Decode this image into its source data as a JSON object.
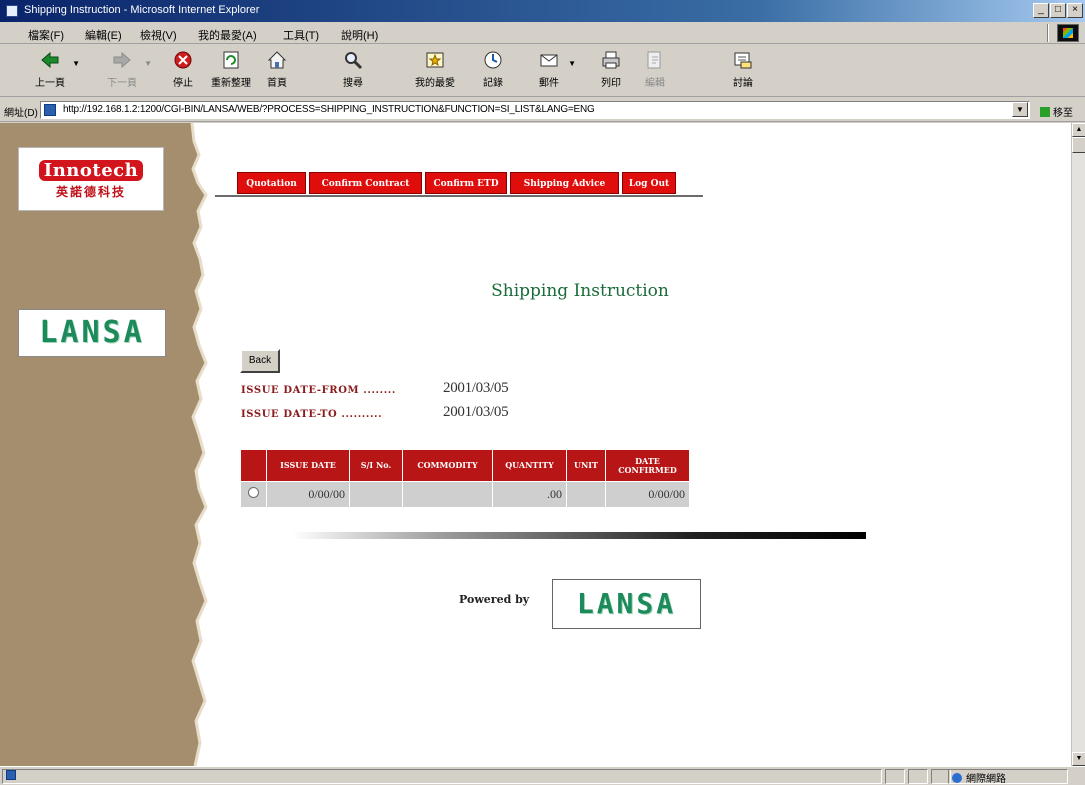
{
  "window": {
    "title": "Shipping Instruction - Microsoft Internet Explorer"
  },
  "menu": [
    "檔案(F)",
    "編輯(E)",
    "檢視(V)",
    "我的最愛(A)",
    "工具(T)",
    "說明(H)"
  ],
  "toolbar": {
    "back": "上一頁",
    "forward": "下一頁",
    "stop": "停止",
    "refresh": "重新整理",
    "home": "首頁",
    "search": "搜尋",
    "favorites": "我的最愛",
    "history": "記錄",
    "mail": "郵件",
    "print": "列印",
    "edit": "編輯",
    "messenger": "討論"
  },
  "address": {
    "label": "網址(D)",
    "url": "http://192.168.1.2:1200/CGI-BIN/LANSA/WEB/?PROCESS=SHIPPING_INSTRUCTION&FUNCTION=SI_LIST&LANG=ENG",
    "go_label": "移至"
  },
  "logos": {
    "innotech_brand": "Innotech",
    "innotech_chinese": "英諾德科技",
    "lanse_brand": "LANSA"
  },
  "nav": {
    "tabs": [
      "Quotation",
      "Confirm Contract",
      "Confirm ETD",
      "Shipping Advice",
      "Log Out"
    ]
  },
  "page": {
    "title": "Shipping Instruction",
    "back_button": "Back",
    "issue_date_from_label": "ISSUE DATE-FROM ........",
    "issue_date_from_value": "2001/03/05",
    "issue_date_to_label": "ISSUE DATE-TO ..........",
    "issue_date_to_value": "2001/03/05",
    "powered_by": "Powered by"
  },
  "table": {
    "headers": [
      "",
      "ISSUE DATE",
      "S/I No.",
      "COMMODITY",
      "QUANTITY",
      "UNIT",
      "DATE CONFIRMED"
    ],
    "rows": [
      [
        "",
        "0/00/00",
        "",
        "",
        ".00",
        "",
        "0/00/00"
      ]
    ]
  },
  "status": {
    "zone": "網際網路"
  },
  "colors": {
    "sidebar": "#a58e6e",
    "nav_red": "#e00d0d",
    "table_header": "#b81616",
    "title_green": "#1b6b3a"
  }
}
